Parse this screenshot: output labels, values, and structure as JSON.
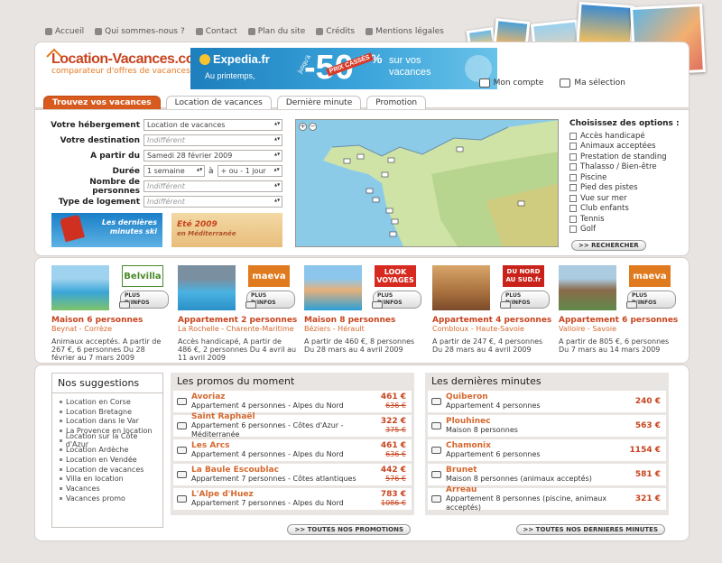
{
  "topnav": [
    {
      "label": "Accueil",
      "icon": "home-icon"
    },
    {
      "label": "Qui sommes-nous ?",
      "icon": "people-icon"
    },
    {
      "label": "Contact",
      "icon": "mail-icon"
    },
    {
      "label": "Plan du site",
      "icon": "sitemap-icon"
    },
    {
      "label": "Crédits",
      "icon": "credits-icon"
    },
    {
      "label": "Mentions légales",
      "icon": "document-icon"
    }
  ],
  "logo": {
    "name": "Location-Vacances.com",
    "tagline": "comparateur d'offres de vacances"
  },
  "banner": {
    "brand": "Expedia.fr",
    "sub": "Au printemps,",
    "upto": "jusqu'à",
    "percent": "-50",
    "pct_sign": "%",
    "stamp": "PRIX CASSÉS",
    "text1": "sur vos",
    "text2": "vacances"
  },
  "account": {
    "my_account": "Mon compte",
    "my_selection": "Ma sélection"
  },
  "tabs": [
    "Trouvez vos vacances",
    "Location de vacances",
    "Dernière minute",
    "Promotion"
  ],
  "form": {
    "accommodation_label": "Votre hébergement",
    "accommodation_value": "Location de vacances",
    "destination_label": "Votre destination",
    "destination_value": "Indifférent",
    "from_label": "A partir du",
    "from_value": "Samedi 28 février 2009",
    "duration_label": "Durée",
    "duration_value": "1 semaine",
    "duration_between": "à",
    "duration_tolerance": "+ ou - 1 jour",
    "persons_label": "Nombre de personnes",
    "persons_value": "Indifférent",
    "type_label": "Type de logement",
    "type_value": "Indifférent"
  },
  "promo_ski": {
    "line1": "Les dernières",
    "line2": "minutes ski"
  },
  "promo_med": {
    "line1": "Eté 2009",
    "line2": "en Méditerranée"
  },
  "options": {
    "title": "Choisissez des options :",
    "items": [
      "Accès handicapé",
      "Animaux acceptées",
      "Prestation de standing",
      "Thalasso / Bien-être",
      "Piscine",
      "Pied des pistes",
      "Vue sur mer",
      "Club enfants",
      "Tennis",
      "Golf"
    ],
    "search_button": ">> RECHERCHER"
  },
  "offers": [
    {
      "brand": "Belvilla",
      "brand_color": "#4a8a2a",
      "plus": "PLUS D'INFOS",
      "title": "Maison 6 personnes",
      "loc": "Beynat - Corrèze",
      "desc": "Animaux acceptés. A partir de 267 €, 6 personnes Du 28 février au 7 mars 2009"
    },
    {
      "brand": "maeva",
      "brand_color": "#e07a1e",
      "plus": "PLUS D'INFOS",
      "title": "Appartement 2 personnes",
      "loc": "La Rochelle - Charente-Maritime",
      "desc": "Accès handicapé, A partir de 486 €, 2 personnes Du 4 avril au 11 avril 2009"
    },
    {
      "brand": "LOOK VOYAGES",
      "brand_color": "#d62a20",
      "plus": "PLUS D'INFOS",
      "title": "Maison 8 personnes",
      "loc": "Béziers - Hérault",
      "desc": "A partir de 460 €, 8 personnes Du 28 mars au 4 avril 2009"
    },
    {
      "brand": "DU NORD AU SUD.fr",
      "brand_color": "#c8221a",
      "plus": "PLUS D'INFOS",
      "title": "Appartement 4 personnes",
      "loc": "Combloux - Haute-Savoie",
      "desc": "A partir de 247 €, 4 personnes Du 28 mars au 4 avril 2009"
    },
    {
      "brand": "maeva",
      "brand_color": "#e07a1e",
      "plus": "PLUS D'INFOS",
      "title": "Appartement 6 personnes",
      "loc": "Valloire - Savoie",
      "desc": "A partir de 805 €, 6 personnes Du 7 mars au 14 mars 2009"
    }
  ],
  "suggestions": {
    "title": "Nos suggestions",
    "items": [
      "Location en Corse",
      "Location Bretagne",
      "Location dans le Var",
      "La Provence en location",
      "Location sur la Côte d'Azur",
      "Location Ardèche",
      "Location en Vendée",
      "Location de vacances",
      "Villa en location",
      "Vacances",
      "Vacances promo"
    ]
  },
  "promos_panel": {
    "title": "Les promos du moment",
    "rows": [
      {
        "city": "Avoriaz",
        "sub": "Appartement 4 personnes - Alpes du Nord",
        "price": "461 €",
        "old": "636 €"
      },
      {
        "city": "Saint Raphaël",
        "sub": "Appartement 6 personnes - Côtes d'Azur - Méditerranée",
        "price": "322 €",
        "old": "375 €"
      },
      {
        "city": "Les Arcs",
        "sub": "Appartement 4 personnes - Alpes du Nord",
        "price": "461 €",
        "old": "636 €"
      },
      {
        "city": "La Baule Escoublac",
        "sub": "Appartement 7 personnes - Côtes atlantiques",
        "price": "442 €",
        "old": "576 €"
      },
      {
        "city": "L'Alpe d'Huez",
        "sub": "Appartement 7 personnes - Alpes du Nord",
        "price": "783 €",
        "old": "1086 €"
      }
    ],
    "more": ">> TOUTES NOS PROMOTIONS"
  },
  "lastmin_panel": {
    "title": "Les dernières minutes",
    "rows": [
      {
        "city": "Quiberon",
        "sub": "Appartement 4 personnes",
        "price": "240 €"
      },
      {
        "city": "Plouhinec",
        "sub": "Maison 8 personnes",
        "price": "563 €"
      },
      {
        "city": "Chamonix",
        "sub": "Appartement 6 personnes",
        "price": "1154 €"
      },
      {
        "city": "Brunet",
        "sub": "Maison 8 personnes (animaux acceptés)",
        "price": "581 €"
      },
      {
        "city": "Arreau",
        "sub": "Appartement 8 personnes (piscine, animaux acceptés)",
        "price": "321 €"
      }
    ],
    "more": ">> TOUTES NOS DERNIERES MINUTES"
  },
  "colors": {
    "accent": "#d85a1e",
    "price": "#c8441f",
    "background": "#e8e4e2"
  }
}
